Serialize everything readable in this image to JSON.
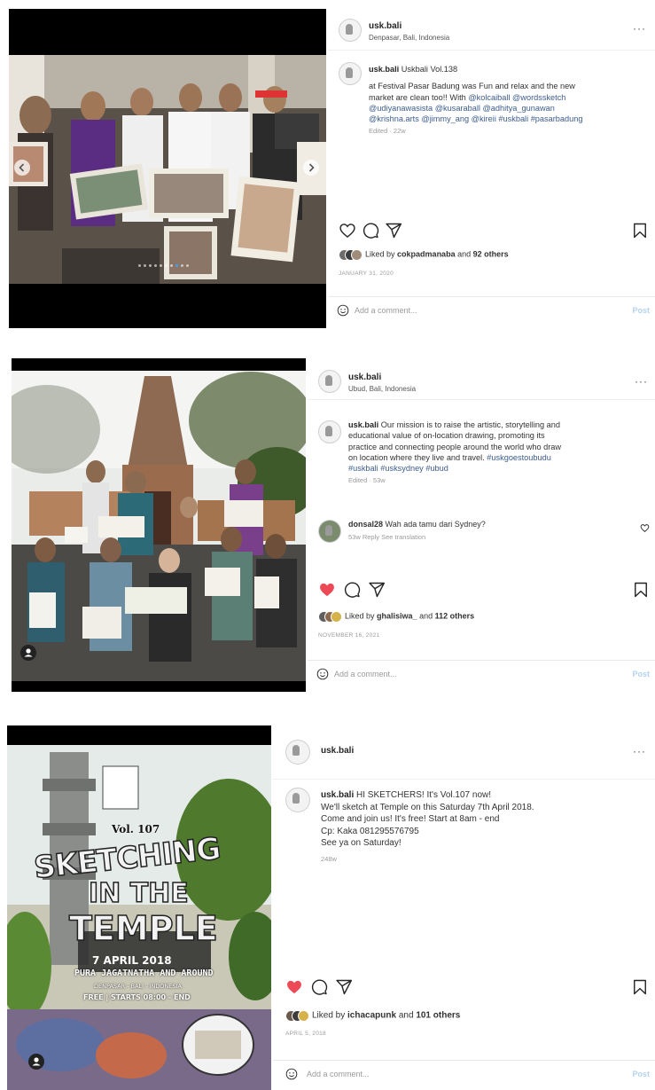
{
  "colors": {
    "like_red": "#ed4956",
    "link_blue": "#3c5c8e",
    "post_blue": "#b5d3f0"
  },
  "posts": [
    {
      "username": "usk.bali",
      "location": "Denpasar, Bali, Indonesia",
      "more": "···",
      "caption_user": "usk.bali",
      "caption_title": "Uskbali Vol.138",
      "caption_lines": [
        "at Festival Pasar Badung was Fun and relax and the new",
        "market are clean too!! With",
        "@udiyanawasista @kusaraball @adhitya_gunawan",
        "@krishna.arts @jimmy_ang @kireii #uskbali #pasarbadung"
      ],
      "caption_line2_tags": "@kolcaiball @wordssketch",
      "edited": "Edited · 22w",
      "liked_by_prefix": "Liked by",
      "liked_by_user": "cokpadmanaba",
      "liked_and": "and",
      "liked_others": "92 others",
      "date": "January 31, 2020",
      "add_comment": "Add a comment...",
      "post_label": "Post",
      "liked": false
    },
    {
      "username": "usk.bali",
      "location": "Ubud, Bali, Indonesia",
      "more": "···",
      "caption_user": "usk.bali",
      "caption_lines": [
        "Our mission is to raise the artistic, storytelling and",
        "educational value of on-location drawing, promoting its",
        "practice and connecting people around the world who draw",
        "on location where they live and travel."
      ],
      "caption_tags_line4": "#uskgoestoubudu",
      "caption_tags_line5": "#uskbali #usksydney #ubud",
      "edited": "Edited · 53w",
      "comment_user": "donsal28",
      "comment_text": "Wah ada tamu dari Sydney?",
      "comment_meta": "53w   Reply   See translation",
      "liked_by_prefix": "Liked by",
      "liked_by_user": "ghalisiwa_",
      "liked_and": "and",
      "liked_others": "112 others",
      "date": "November 16, 2021",
      "add_comment": "Add a comment...",
      "post_label": "Post",
      "liked": true
    },
    {
      "username": "usk.bali",
      "more": "···",
      "caption_user": "usk.bali",
      "caption_lines": [
        "HI SKETCHERS! It's Vol.107 now!",
        "We'll sketch at Temple on this Saturday 7th April 2018.",
        "Come and join us! It's free! Start at 8am - end",
        "Cp: Kaka 081295576795",
        "See ya on Saturday!"
      ],
      "age": "248w",
      "poster": {
        "vol": "Vol. 107",
        "line1": "SKETCHING",
        "line2": "IN THE",
        "line3": "TEMPLE",
        "date": "7 APRIL 2018",
        "place": "PURA JAGATNATHA AND AROUND",
        "city": "DENPASAR - BALI - INDONESIA",
        "free": "FREE | STARTS 08:00 - END"
      },
      "liked_by_prefix": "Liked by",
      "liked_by_user": "ichacapunk",
      "liked_and": "and",
      "liked_others": "101 others",
      "date": "April 5, 2018",
      "add_comment": "Add a comment...",
      "post_label": "Post",
      "liked": true
    }
  ]
}
